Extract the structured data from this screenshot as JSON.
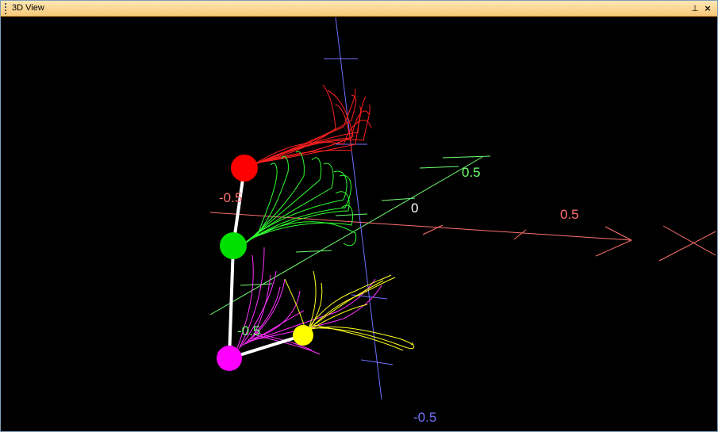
{
  "window": {
    "title": "3D View",
    "pin_glyph": "⊥",
    "close_glyph": "×"
  },
  "axis_labels": {
    "x_neg": "-0.5",
    "x_pos": "0.5",
    "origin": "0",
    "y_neg": "-0.5",
    "y_pos": "0.5",
    "z_neg": "-0.5"
  },
  "colors": {
    "x_axis": "#ff7070",
    "y_axis": "#70ff70",
    "z_axis": "#7070ff",
    "origin_label": "#ffffff",
    "joint_top": "#ff0000",
    "joint_middle": "#00e000",
    "joint_bottom": "#ff00ff",
    "joint_end": "#ffff00",
    "skeleton": "#ffffff"
  },
  "joints": [
    "joint-top",
    "joint-middle",
    "joint-bottom",
    "joint-end"
  ],
  "icons": {
    "drag-grip": "grip-icon",
    "pin": "pin-icon",
    "close": "close-icon"
  }
}
